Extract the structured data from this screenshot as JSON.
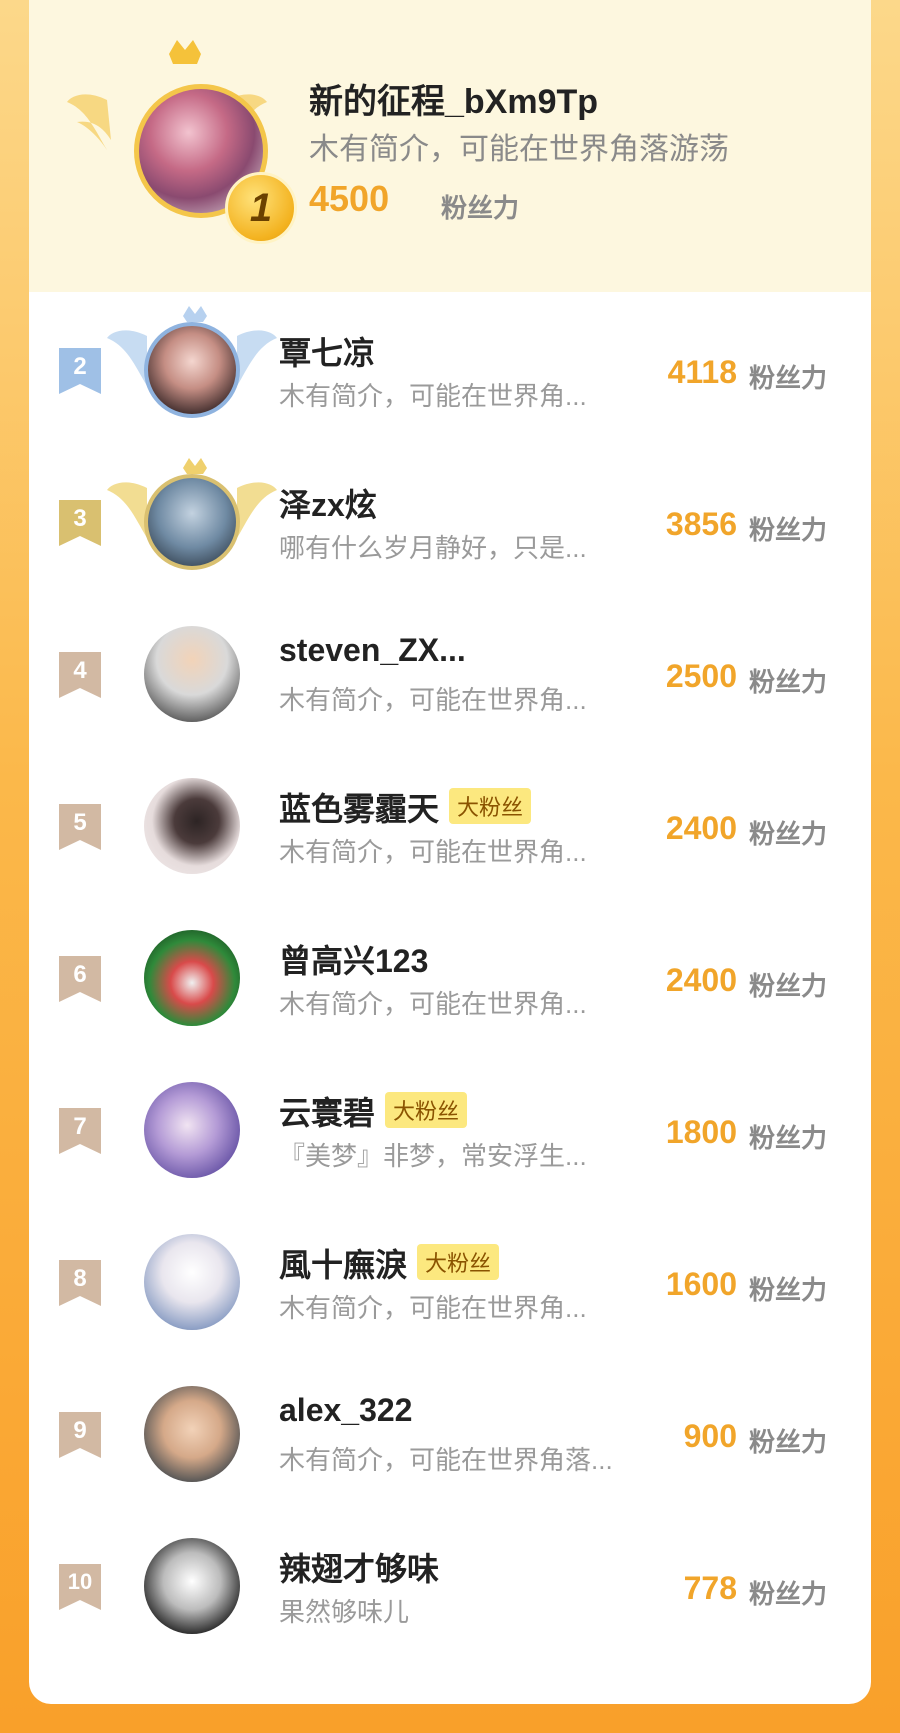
{
  "leader": {
    "rank": "1",
    "name": "新的征程_bXm9Tp",
    "bio": "木有简介，可能在世界角落游荡",
    "score": "4500",
    "unit": "粉丝力"
  },
  "rows": [
    {
      "rank": "2",
      "name": "覃七凉",
      "tag": "",
      "bio": "木有简介，可能在世界角...",
      "score": "4118",
      "unit": "粉丝力"
    },
    {
      "rank": "3",
      "name": "泽zx炫",
      "tag": "",
      "bio": "哪有什么岁月静好，只是...",
      "score": "3856",
      "unit": "粉丝力"
    },
    {
      "rank": "4",
      "name": "steven_ZX...",
      "tag": "",
      "bio": "木有简介，可能在世界角...",
      "score": "2500",
      "unit": "粉丝力"
    },
    {
      "rank": "5",
      "name": "蓝色雾霾天",
      "tag": "大粉丝",
      "bio": "木有简介，可能在世界角...",
      "score": "2400",
      "unit": "粉丝力"
    },
    {
      "rank": "6",
      "name": "曾高兴123",
      "tag": "",
      "bio": "木有简介，可能在世界角...",
      "score": "2400",
      "unit": "粉丝力"
    },
    {
      "rank": "7",
      "name": "云寰碧",
      "tag": "大粉丝",
      "bio": "『美梦』非梦，常安浮生...",
      "score": "1800",
      "unit": "粉丝力"
    },
    {
      "rank": "8",
      "name": "風十廡淚",
      "tag": "大粉丝",
      "bio": "木有简介，可能在世界角...",
      "score": "1600",
      "unit": "粉丝力"
    },
    {
      "rank": "9",
      "name": "alex_322",
      "tag": "",
      "bio": "木有简介，可能在世界角落...",
      "score": "900",
      "unit": "粉丝力"
    },
    {
      "rank": "10",
      "name": "辣翅才够味",
      "tag": "",
      "bio": "果然够味儿",
      "score": "778",
      "unit": "粉丝力"
    }
  ],
  "colors": {
    "score": "#f1a52a",
    "rank2_flag": "#9fc0e6",
    "rank3_flag": "#d9c070",
    "rank_other_flag": "#d2b9a3",
    "fan_tag_bg": "#fce87f"
  },
  "icons": {
    "crown": "crown-icon",
    "wings": "wings-icon",
    "rank_flag": "rank-flag-icon"
  }
}
